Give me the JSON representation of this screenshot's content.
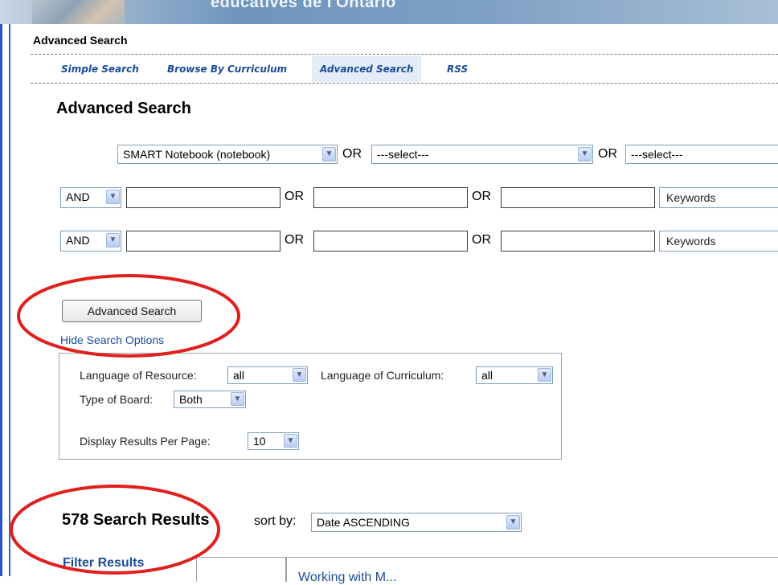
{
  "banner": {
    "text": "éducatives de l'Ontario"
  },
  "breadcrumb": "Advanced Search",
  "tabs": [
    {
      "label": "Simple Search"
    },
    {
      "label": "Browse By Curriculum"
    },
    {
      "label": "Advanced Search",
      "active": true
    },
    {
      "label": "RSS"
    }
  ],
  "page_title": "Advanced Search",
  "row1": {
    "select1": "SMART Notebook (notebook)",
    "or1": "OR",
    "select2": "---select---",
    "or2": "OR",
    "select3": "---select---"
  },
  "row2": {
    "op": "AND",
    "field1": "",
    "or1": "OR",
    "field2": "",
    "or2": "OR",
    "field3": "",
    "keywords": "Keywords"
  },
  "row3": {
    "op": "AND",
    "field1": "",
    "or1": "OR",
    "field2": "",
    "or2": "OR",
    "field3": "",
    "keywords": "Keywords"
  },
  "advanced_search_button": "Advanced Search",
  "hide_options_link": "Hide Search Options",
  "options": {
    "language_resource_label": "Language of Resource:",
    "language_resource_value": "all",
    "language_curriculum_label": "Language of Curriculum:",
    "language_curriculum_value": "all",
    "board_label": "Type of Board:",
    "board_value": "Both",
    "per_page_label": "Display Results Per Page:",
    "per_page_value": "10"
  },
  "results": {
    "count_text": "578 Search Results",
    "sort_label": "sort by:",
    "sort_value": "Date ASCENDING"
  },
  "filter_label": "Filter Results",
  "result_preview": "Working with M...",
  "colors": {
    "link": "#1a4b9b",
    "annotation": "#e0201c",
    "sidebar_accent": "#2a55c8"
  }
}
